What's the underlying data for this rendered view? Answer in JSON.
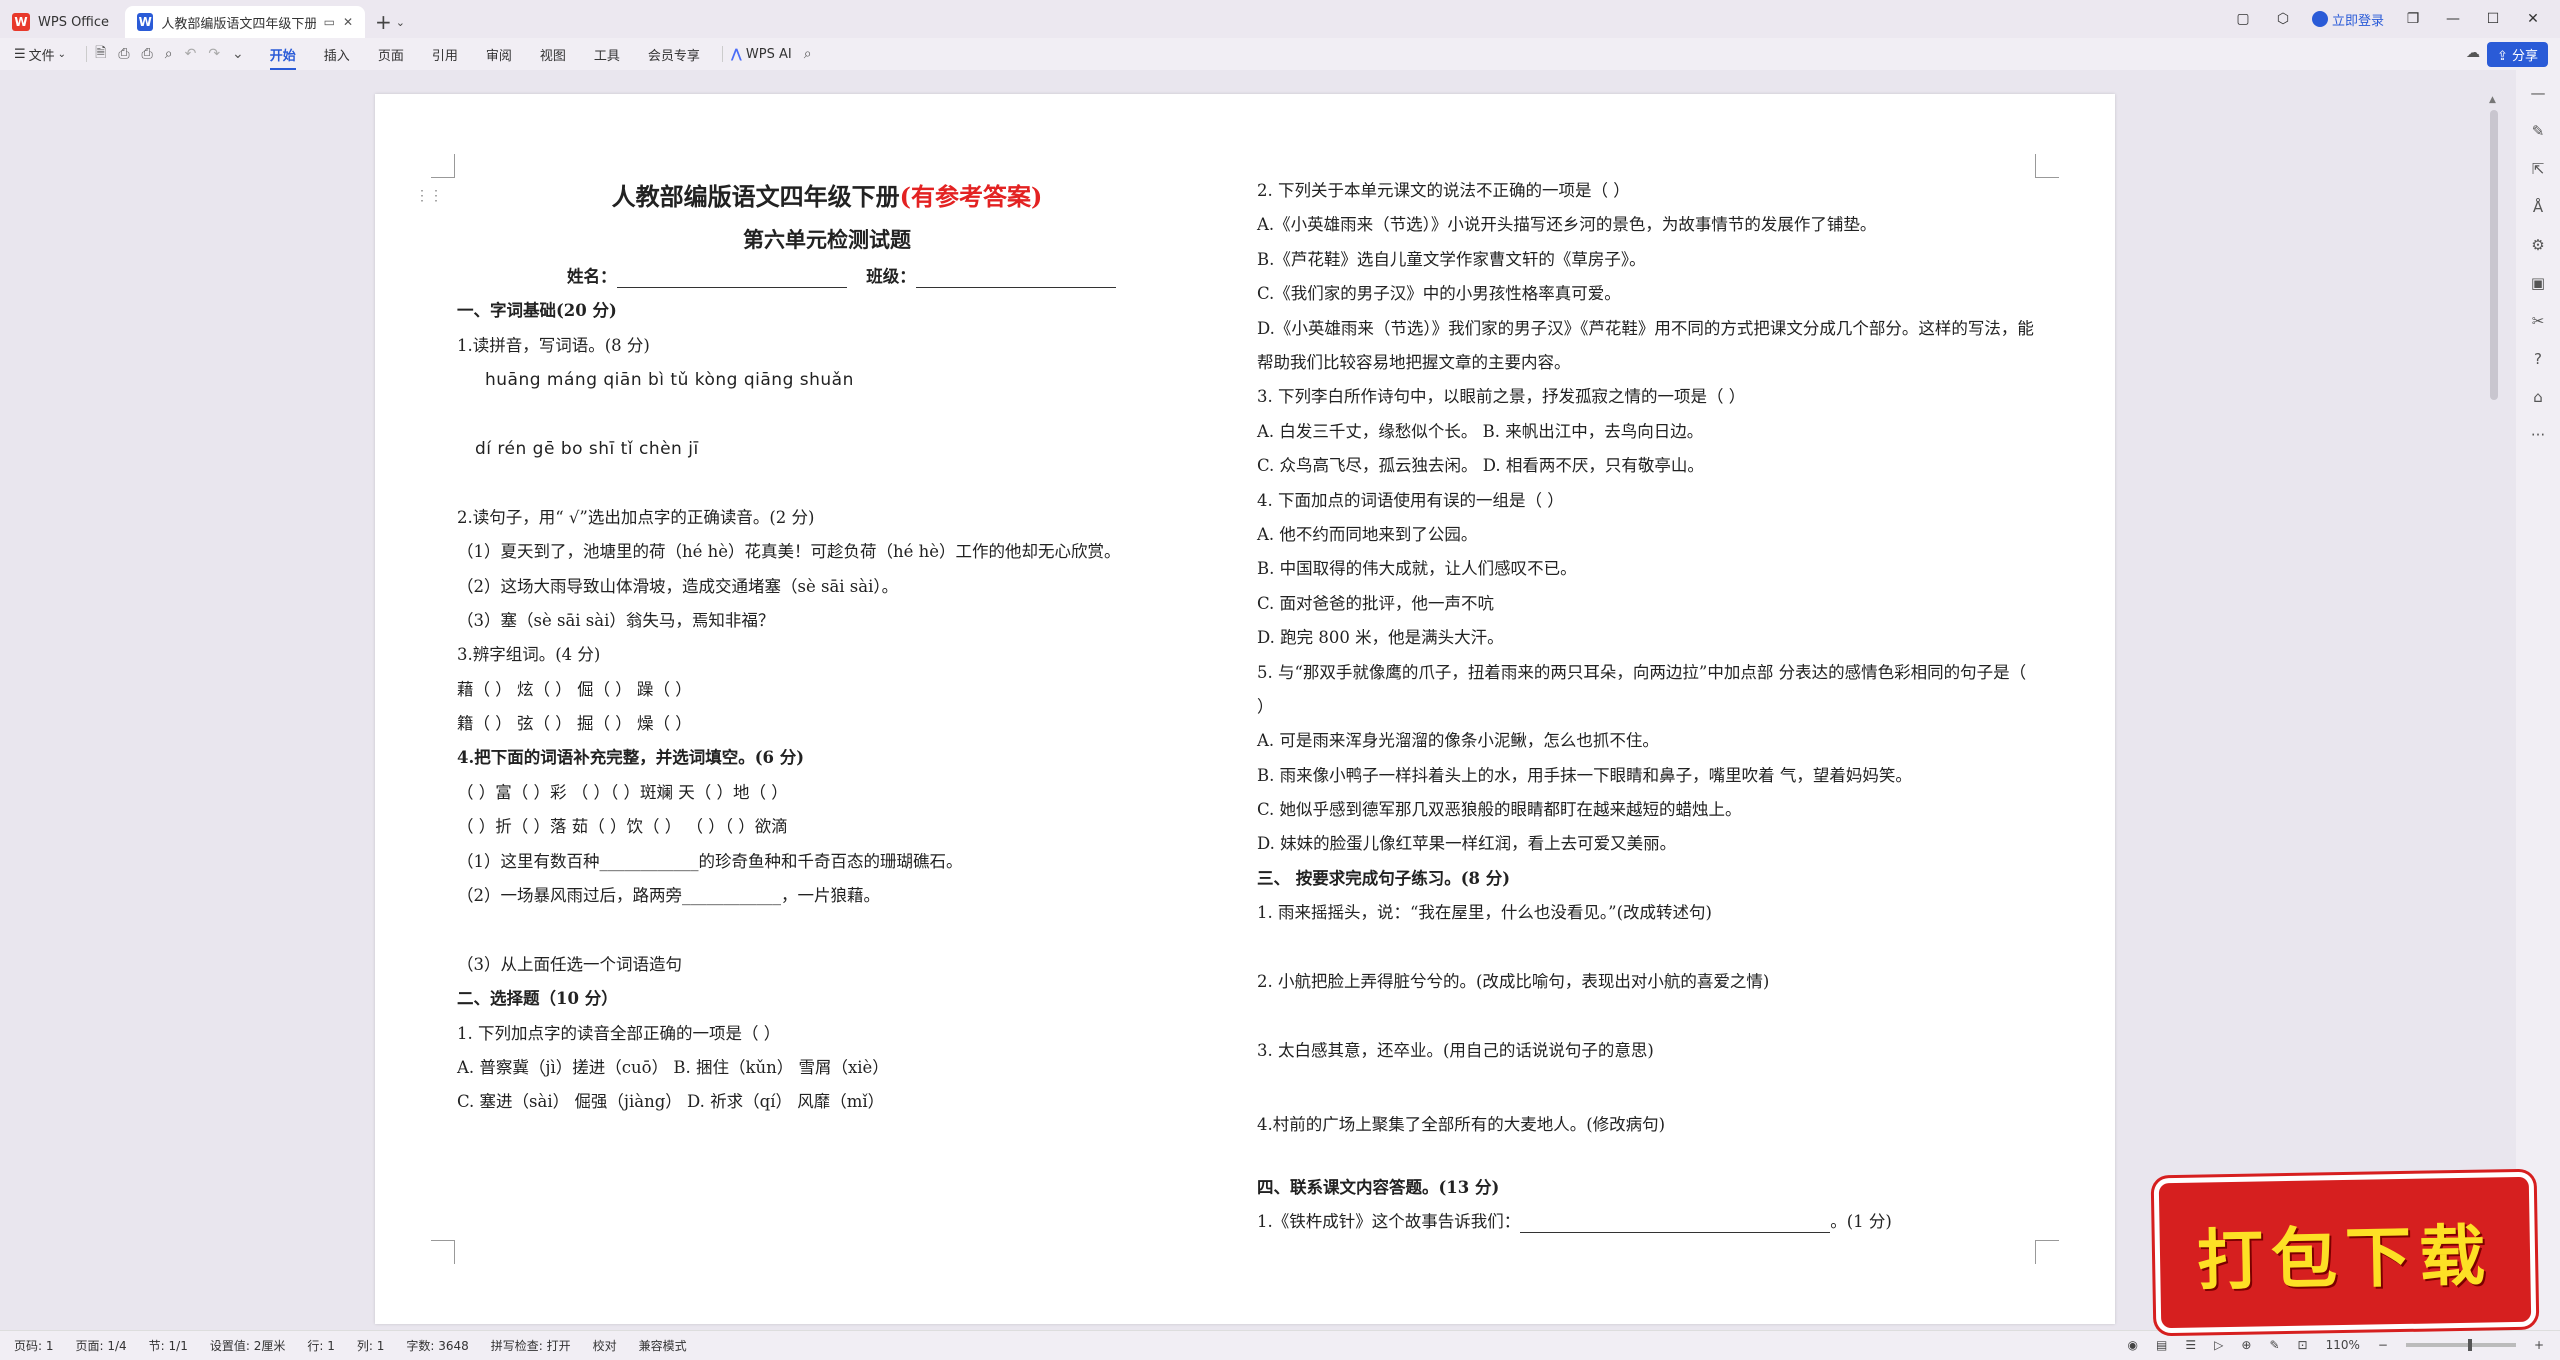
{
  "tabs": {
    "home_label": "WPS Office",
    "doc_label": "人教部编版语文四年级下册新"
  },
  "window": {
    "login_label": "立即登录"
  },
  "toolbar": {
    "file_label": "文件",
    "menus": [
      "开始",
      "插入",
      "页面",
      "引用",
      "审阅",
      "视图",
      "工具",
      "会员专享"
    ],
    "ai_label": "WPS AI",
    "share_label": "分享"
  },
  "doc": {
    "title_black": "人教部编版语文四年级下册",
    "title_red": "(有参考答案)",
    "subtitle": "第六单元检测试题",
    "name_line": "姓名：",
    "class_line": "班级：",
    "left": [
      "一、字词基础(20 分)",
      "1.读拼音，写词语。(8 分)",
      "huāng máng    qiān bì tǔ kòng    qiāng shuǎn",
      "dí rén gē bo shī tǐ    chèn jī",
      "2.读句子，用“ √”选出加点字的正确读音。(2 分)",
      "（1）夏天到了，池塘里的荷（hé  hè）花真美！可趁负荷（hé  hè）工作的他却无心欣赏。",
      "（2）这场大雨导致山体滑坡，造成交通堵塞（sè  sāi  sài）。",
      "（3）塞（sè  sāi  sài）翁失马，焉知非福？",
      "3.辨字组词。(4 分)",
      "藉（        ）      炫（        ）      倔（        ）      躁（        ）",
      "籍（        ）      弦（        ）      掘（        ）      燥（        ）",
      "4.把下面的词语补充完整，并选词填空。(6 分)",
      "（    ）富（    ）彩      （    ）（    ）斑斓      天（    ）地（    ）",
      "（    ）折（    ）落      茹（    ）饮（    ）      （    ）（    ）欲滴",
      "（1）这里有数百种____________的珍奇鱼种和千奇百态的珊瑚礁石。",
      "（2）一场暴风雨过后，路两旁____________，一片狼藉。",
      "（3）从上面任选一个词语造句",
      "二、选择题（10 分）",
      "1. 下列加点字的读音全部正确的一项是（      ）",
      "A. 普察冀（jì）搓进（cuō）       B. 捆住（kǔn）    雪屑（xiè）",
      "C. 塞进（sài）    倔强（jiàng）  D. 祈求（qí）    风靡（mǐ）"
    ],
    "right": [
      "2. 下列关于本单元课文的说法不正确的一项是（      ）",
      "A.《小英雄雨来（节选）》小说开头描写还乡河的景色，为故事情节的发展作了铺垫。",
      "B.《芦花鞋》选自儿童文学作家曹文轩的《草房子》。",
      "C.《我们家的男子汉》中的小男孩性格率真可爱。",
      "D.《小英雄雨来（节选）》我们家的男子汉》《芦花鞋》用不同的方式把课文分成几个部分。这样的写法，能帮助我们比较容易地把握文章的主要内容。",
      "3. 下列李白所作诗句中，以眼前之景，抒发孤寂之情的一项是（      ）",
      "A. 白发三千丈，缘愁似个长。            B. 来帆出江中，去鸟向日边。",
      "C. 众鸟高飞尽，孤云独去闲。            D. 相看两不厌，只有敬亭山。",
      "4. 下面加点的词语使用有误的一组是（      ）",
      "A. 他不约而同地来到了公园。",
      "B. 中国取得的伟大成就，让人们感叹不已。",
      "C. 面对爸爸的批评，他一声不吭",
      "D. 跑完 800 米，他是满头大汗。",
      "5. 与“那双手就像鹰的爪子，扭着雨来的两只耳朵，向两边拉”中加点部    分表达的感情色彩相同的句子是（      ）",
      "A. 可是雨来浑身光溜溜的像条小泥鳅，怎么也抓不住。",
      "B. 雨来像小鸭子一样抖着头上的水，用手抹一下眼睛和鼻子，嘴里吹着    气，望着妈妈笑。",
      "C. 她似乎感到德军那几双恶狼般的眼睛都盯在越来越短的蜡烛上。",
      "D. 妹妹的脸蛋儿像红苹果一样红润，看上去可爱又美丽。",
      "三、  按要求完成句子练习。(8 分)",
      "1. 雨来摇摇头，说：“我在屋里，什么也没看见。”(改成转述句)",
      "2. 小航把脸上弄得脏兮兮的。(改成比喻句，表现出对小航的喜爱之情)",
      "3. 太白感其意，还卒业。(用自己的话说说句子的意思)",
      "4.村前的广场上聚集了全部所有的大麦地人。(修改病句)",
      "四、联系课文内容答题。(13 分)",
      "1.《铁杵成针》这个故事告诉我们：",
      "。(1 分)"
    ]
  },
  "status": {
    "page_code": "页码: 1",
    "pages": "页面: 1/4",
    "section": "节: 1/1",
    "setting": "设置值: 2厘米",
    "row": "行: 1",
    "column": "列: 1",
    "wordcount": "字数: 3648",
    "spellcheck": "拼写检查: 打开",
    "proofread": "校对",
    "compat": "兼容模式",
    "zoom": "110%"
  },
  "badge": {
    "text": "打包下载"
  },
  "colors": {
    "accent": "#2a5bd7",
    "title_red": "#e32222",
    "badge_bg": "#d61f1f",
    "badge_text": "#fde025"
  }
}
